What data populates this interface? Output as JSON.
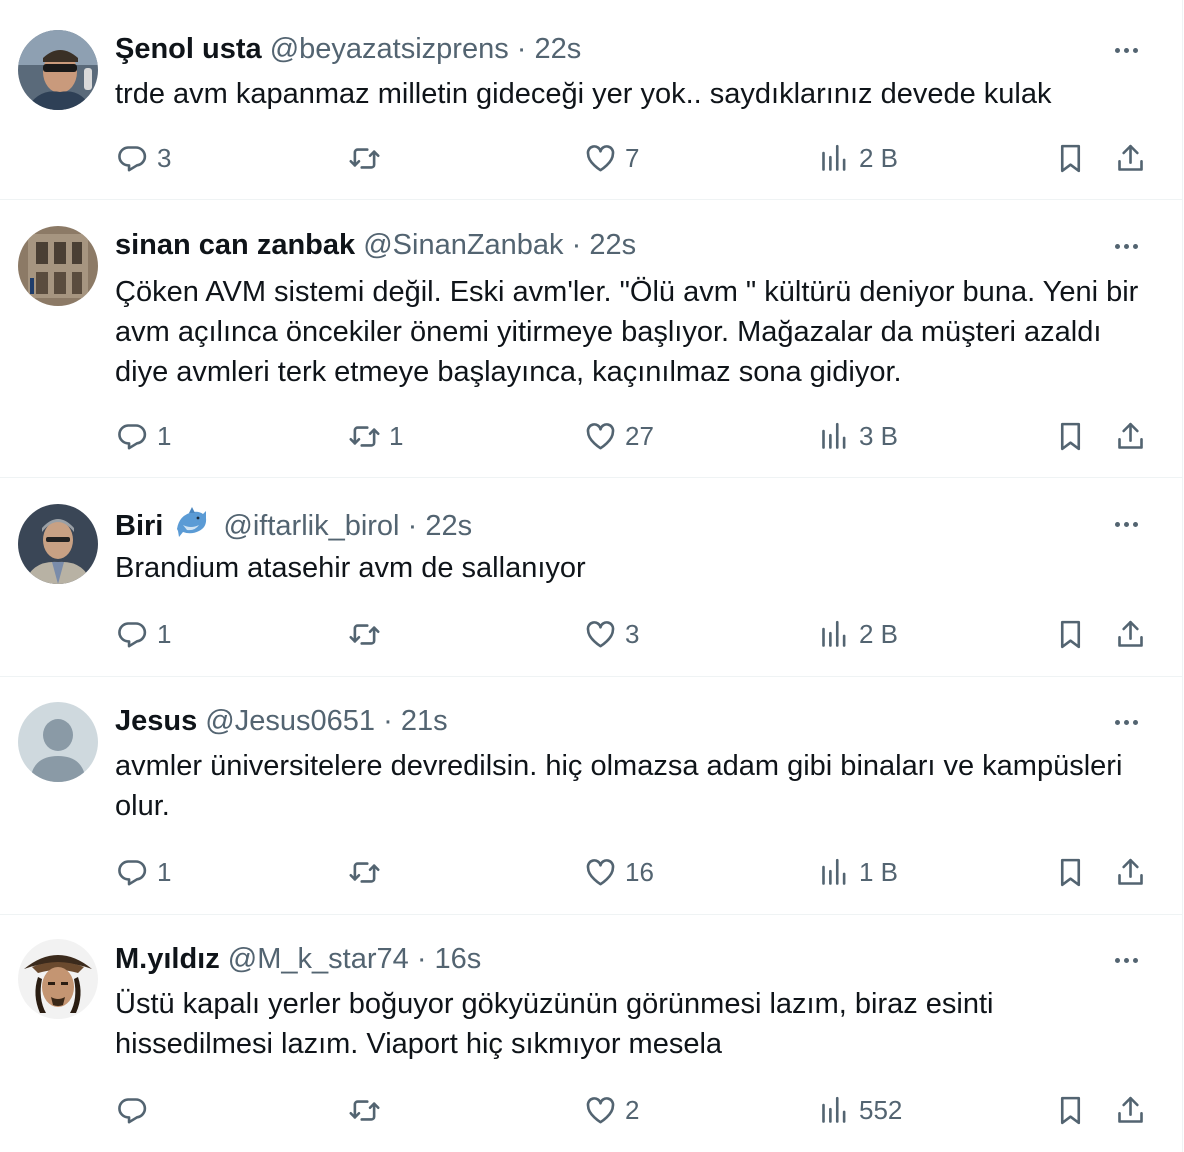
{
  "tweets": [
    {
      "name": "Şenol usta",
      "handle": "@beyazatsizprens",
      "time": "22s",
      "text": "trde avm kapanmaz milletin gideceği yer yok.. saydıklarınız devede kulak",
      "replies": "3",
      "retweets": "",
      "likes": "7",
      "views": "2 B"
    },
    {
      "name": "sinan can zanbak",
      "handle": "@SinanZanbak",
      "time": "22s",
      "text": "Çöken AVM sistemi değil. Eski avm'ler. \"Ölü avm \" kültürü deniyor buna. Yeni bir avm açılınca öncekiler önemi yitirmeye başlıyor. Mağazalar da müşteri azaldı diye avmleri terk etmeye başlayınca, kaçınılmaz sona gidiyor.",
      "replies": "1",
      "retweets": "1",
      "likes": "27",
      "views": "3 B"
    },
    {
      "name": "Biri",
      "handle": "@iftarlik_birol",
      "time": "22s",
      "text": "Brandium atasehir avm de sallanıyor",
      "replies": "1",
      "retweets": "",
      "likes": "3",
      "views": "2 B"
    },
    {
      "name": "Jesus",
      "handle": "@Jesus0651",
      "time": "21s",
      "text": "avmler üniversitelere devredilsin. hiç olmazsa adam gibi binaları ve kampüsleri olur.",
      "replies": "1",
      "retweets": "",
      "likes": "16",
      "views": "1 B"
    },
    {
      "name": "M.yıldız",
      "handle": "@M_k_star74",
      "time": "16s",
      "text": "Üstü kapalı yerler boğuyor  gökyüzünün görünmesi lazım, biraz esinti hissedilmesi lazım. Viaport hiç sıkmıyor mesela",
      "replies": "",
      "retweets": "",
      "likes": "2",
      "views": "552"
    }
  ],
  "separator": "·",
  "icons": {
    "reply": "reply-icon",
    "retweet": "retweet-icon",
    "like": "heart-icon",
    "views": "views-icon",
    "bookmark": "bookmark-icon",
    "share": "share-icon",
    "more": "more-icon",
    "badge": "dolphin-emoji-icon"
  },
  "colors": {
    "text": "#0f1419",
    "secondary": "#536471",
    "divider": "#eff3f4"
  }
}
